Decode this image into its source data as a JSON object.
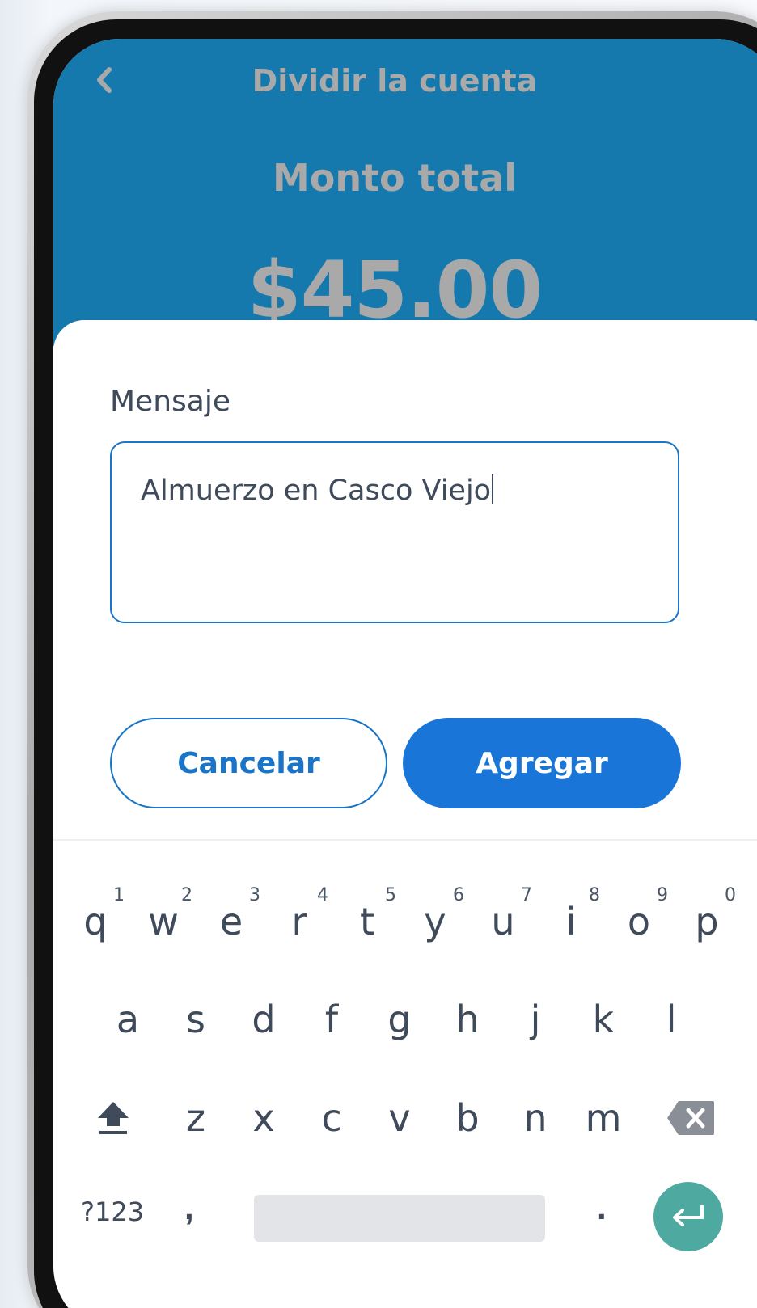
{
  "header": {
    "title": "Dividir la cuenta",
    "total_label": "Monto total",
    "amount": "$45.00"
  },
  "message": {
    "label": "Mensaje",
    "value": "Almuerzo en Casco Viejo"
  },
  "actions": {
    "cancel_label": "Cancelar",
    "add_label": "Agregar"
  },
  "keyboard": {
    "row1": [
      {
        "key": "q",
        "num": "1"
      },
      {
        "key": "w",
        "num": "2"
      },
      {
        "key": "e",
        "num": "3"
      },
      {
        "key": "r",
        "num": "4"
      },
      {
        "key": "t",
        "num": "5"
      },
      {
        "key": "y",
        "num": "6"
      },
      {
        "key": "u",
        "num": "7"
      },
      {
        "key": "i",
        "num": "8"
      },
      {
        "key": "o",
        "num": "9"
      },
      {
        "key": "p",
        "num": "0"
      }
    ],
    "row2": [
      "a",
      "s",
      "d",
      "f",
      "g",
      "h",
      "j",
      "k",
      "l"
    ],
    "row3": [
      "z",
      "x",
      "c",
      "v",
      "b",
      "n",
      "m"
    ],
    "symbols_label": "?123",
    "comma": ",",
    "period": ".",
    "shift_icon": "shift-icon",
    "backspace_icon": "backspace-icon",
    "enter_icon": "enter-icon"
  },
  "colors": {
    "header_bg": "#1679ad",
    "primary": "#1976d8",
    "enter_key": "#4eaaa0"
  }
}
